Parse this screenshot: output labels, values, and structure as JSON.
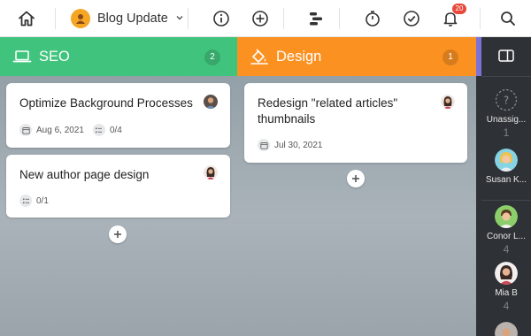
{
  "topbar": {
    "project_name": "Blog Update",
    "notification_count": "20",
    "icons": [
      "home-icon",
      "project-avatar-icon",
      "chevron-down-icon",
      "info-icon",
      "add-icon",
      "timeline-icon",
      "timer-icon",
      "check-circle-icon",
      "bell-icon",
      "search-icon"
    ]
  },
  "columns": [
    {
      "title": "SEO",
      "count": "2",
      "color": "#40c47d",
      "icon": "laptop-icon",
      "cards": [
        {
          "title": "Optimize Background Processes",
          "date": "Aug 6, 2021",
          "checklist": "0/4"
        },
        {
          "title": "New author page design",
          "checklist": "0/1"
        }
      ]
    },
    {
      "title": "Design",
      "count": "1",
      "color": "#fb9121",
      "icon": "paint-bucket-icon",
      "cards": [
        {
          "title": "Redesign \"related articles\" thumbnails",
          "date": "Jul 30, 2021"
        }
      ]
    }
  ],
  "sidebar": {
    "users": [
      {
        "name": "Unassig...",
        "count": "1"
      },
      {
        "name": "Susan K..."
      },
      {
        "name": "Conor L...",
        "count": "4"
      },
      {
        "name": "Mia B",
        "count": "4"
      }
    ]
  }
}
